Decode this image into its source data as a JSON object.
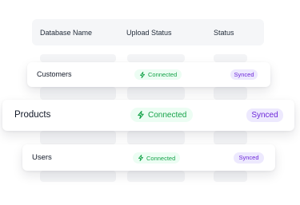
{
  "table": {
    "headers": [
      "Database Name",
      "Upload Status",
      "Status"
    ],
    "rows": [
      {
        "name": "Customers",
        "upload_status": "Connected",
        "status": "Synced"
      },
      {
        "name": "Products",
        "upload_status": "Connected",
        "status": "Synced"
      },
      {
        "name": "Users",
        "upload_status": "Connected",
        "status": "Synced"
      }
    ]
  },
  "icons": {
    "upload_status": "lightning-bolt-icon"
  },
  "colors": {
    "connected_text": "#16a34a",
    "connected_bg": "#ecfdf3",
    "synced_text": "#6d28d9",
    "synced_bg": "#ede9fe",
    "header_bg": "#f5f6f8",
    "placeholder_bg": "#f3f4f6"
  }
}
